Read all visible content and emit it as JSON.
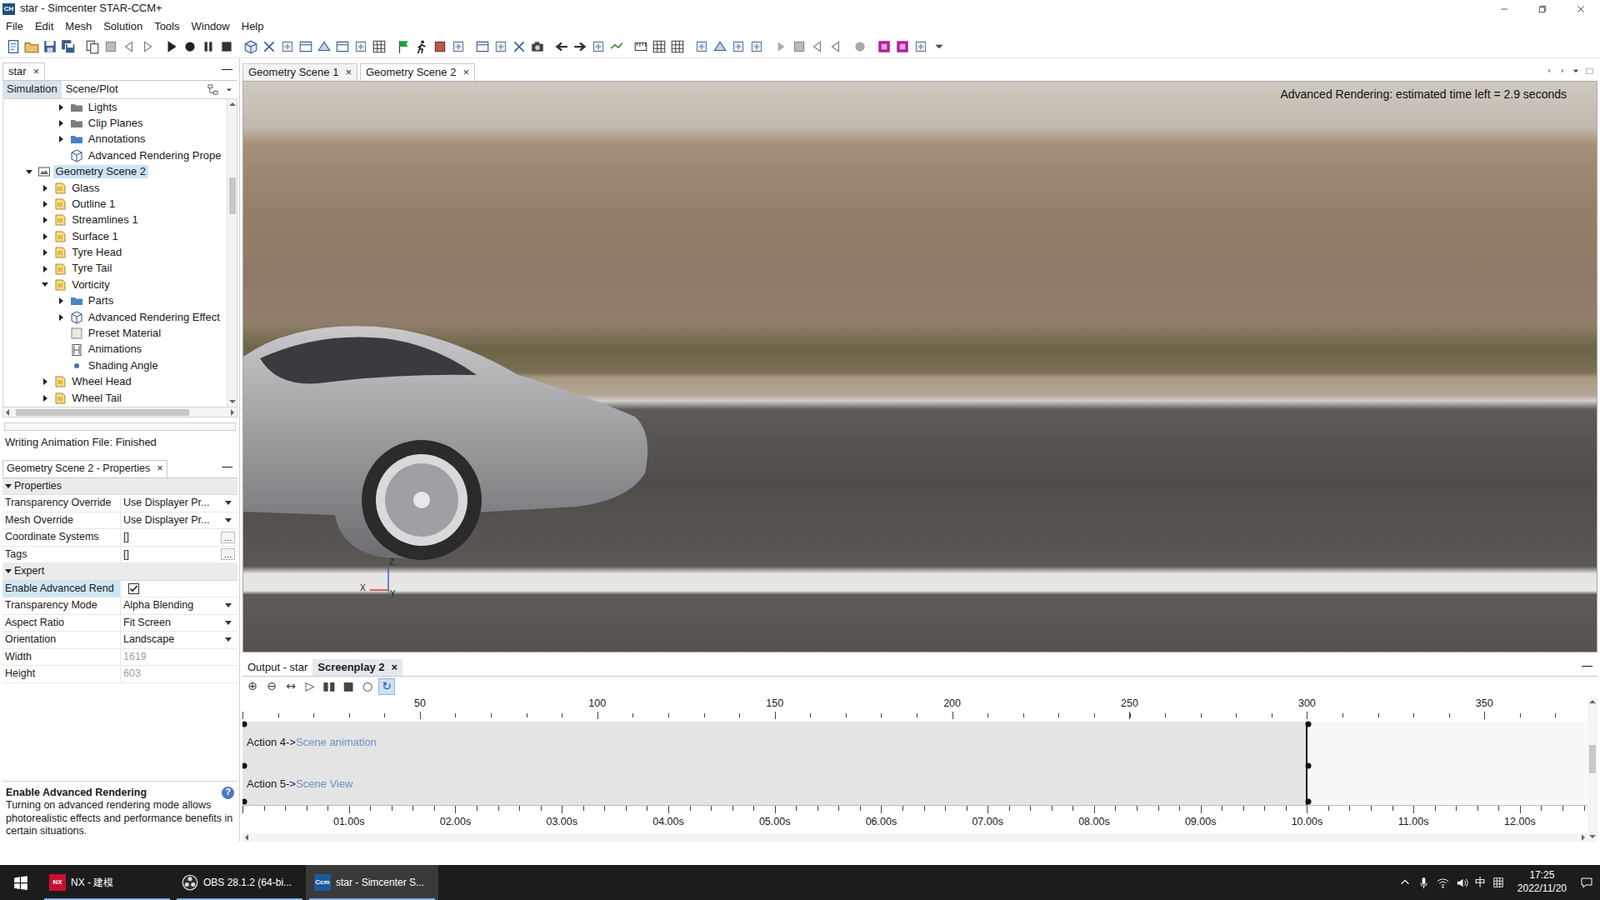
{
  "window": {
    "app_icon": "CH",
    "title": "star - Simcenter STAR-CCM+"
  },
  "menu": [
    "File",
    "Edit",
    "Mesh",
    "Solution",
    "Tools",
    "Window",
    "Help"
  ],
  "sim_panel": {
    "tabs": [
      {
        "label": "star",
        "close": "×",
        "selected": true
      }
    ],
    "minimize": "—",
    "views": [
      {
        "label": "Simulation",
        "selected": true
      },
      {
        "label": "Scene/Plot",
        "selected": false
      }
    ]
  },
  "tree": [
    {
      "label": "Lights",
      "depth": 3,
      "kind": "folder",
      "expandable": true,
      "expanded": false,
      "selected": false
    },
    {
      "label": "Clip Planes",
      "depth": 3,
      "kind": "folder",
      "expandable": true,
      "expanded": false,
      "selected": false
    },
    {
      "label": "Annotations",
      "depth": 3,
      "kind": "folder-blue",
      "expandable": true,
      "expanded": false,
      "selected": false
    },
    {
      "label": "Advanced Rendering Prope",
      "depth": 3,
      "kind": "cube",
      "expandable": false,
      "expanded": false,
      "selected": false
    },
    {
      "label": "Geometry Scene 2",
      "depth": 1,
      "kind": "scene",
      "expandable": true,
      "expanded": true,
      "selected": true
    },
    {
      "label": "Glass",
      "depth": 2,
      "kind": "displayer",
      "expandable": true,
      "expanded": false,
      "selected": false
    },
    {
      "label": "Outline 1",
      "depth": 2,
      "kind": "displayer",
      "expandable": true,
      "expanded": false,
      "selected": false
    },
    {
      "label": "Streamlines 1",
      "depth": 2,
      "kind": "displayer",
      "expandable": true,
      "expanded": false,
      "selected": false
    },
    {
      "label": "Surface 1",
      "depth": 2,
      "kind": "displayer",
      "expandable": true,
      "expanded": false,
      "selected": false
    },
    {
      "label": "Tyre Head",
      "depth": 2,
      "kind": "displayer",
      "expandable": true,
      "expanded": false,
      "selected": false
    },
    {
      "label": "Tyre Tail",
      "depth": 2,
      "kind": "displayer",
      "expandable": true,
      "expanded": false,
      "selected": false
    },
    {
      "label": "Vorticity",
      "depth": 2,
      "kind": "displayer",
      "expandable": true,
      "expanded": true,
      "selected": false
    },
    {
      "label": "Parts",
      "depth": 3,
      "kind": "folder-blue",
      "expandable": true,
      "expanded": false,
      "selected": false
    },
    {
      "label": "Advanced Rendering Effect",
      "depth": 3,
      "kind": "cube",
      "expandable": true,
      "expanded": false,
      "selected": false
    },
    {
      "label": "Preset Material",
      "depth": 3,
      "kind": "material",
      "expandable": false,
      "expanded": false,
      "selected": false
    },
    {
      "label": "Animations",
      "depth": 3,
      "kind": "film",
      "expandable": false,
      "expanded": false,
      "selected": false
    },
    {
      "label": "Shading Angle",
      "depth": 3,
      "kind": "dot",
      "expandable": false,
      "expanded": false,
      "selected": false
    },
    {
      "label": "Wheel Head",
      "depth": 2,
      "kind": "displayer",
      "expandable": true,
      "expanded": false,
      "selected": false
    },
    {
      "label": "Wheel Tail",
      "depth": 2,
      "kind": "displayer",
      "expandable": true,
      "expanded": false,
      "selected": false
    }
  ],
  "tree_status": {
    "level": 0,
    "text": "Writing Animation File: Finished"
  },
  "properties": {
    "title": "Geometry Scene 2 - Properties",
    "close": "×",
    "minimize": "—",
    "sections": [
      {
        "label": "Properties",
        "expanded": true,
        "rows": [
          {
            "name": "Transparency Override",
            "value": "Use Displayer Pr...",
            "kind": "dropdown",
            "selected": false,
            "disabled": false
          },
          {
            "name": "Mesh Override",
            "value": "Use Displayer Pr...",
            "kind": "dropdown",
            "selected": false,
            "disabled": false
          },
          {
            "name": "Coordinate Systems",
            "value": "[]",
            "kind": "button",
            "button": "...",
            "selected": false,
            "disabled": false
          },
          {
            "name": "Tags",
            "value": "[]",
            "kind": "button",
            "button": "...",
            "selected": false,
            "disabled": false
          }
        ]
      },
      {
        "label": "Expert",
        "expanded": true,
        "rows": [
          {
            "name": "Enable Advanced Rend",
            "kind": "checkbox",
            "checked": true,
            "selected": true,
            "disabled": false
          },
          {
            "name": "Transparency Mode",
            "value": "Alpha Blending",
            "kind": "dropdown",
            "selected": false,
            "disabled": false
          },
          {
            "name": "Aspect Ratio",
            "value": "Fit Screen",
            "kind": "dropdown",
            "selected": false,
            "disabled": false
          },
          {
            "name": "Orientation",
            "value": "Landscape",
            "kind": "dropdown",
            "selected": false,
            "disabled": false
          },
          {
            "name": "Width",
            "value": "1619",
            "kind": "text",
            "selected": false,
            "disabled": true
          },
          {
            "name": "Height",
            "value": "603",
            "kind": "text",
            "selected": false,
            "disabled": true
          }
        ]
      }
    ],
    "help": {
      "title": "Enable Advanced Rendering",
      "icon": "?",
      "text": "Turning on advanced rendering mode allows photorealistic effects and performance benefits in certain situations."
    }
  },
  "scene_tabs": [
    {
      "label": "Geometry Scene 1",
      "close": "×",
      "selected": false
    },
    {
      "label": "Geometry Scene 2",
      "close": "×",
      "selected": true
    }
  ],
  "viewport": {
    "overlay": "Advanced Rendering: estimated time left = 2.9 seconds",
    "axes": {
      "z": "Z",
      "x": "X",
      "y": "Y"
    }
  },
  "screenplay": {
    "tabs": [
      {
        "label": "Output - star",
        "selected": false
      },
      {
        "label": "Screenplay 2",
        "close": "×",
        "selected": true
      }
    ],
    "minimize": "—",
    "controls": [
      {
        "glyph": "⊕",
        "on": false
      },
      {
        "glyph": "⊖",
        "on": false
      },
      {
        "glyph": "↔",
        "on": false
      },
      {
        "glyph": "▷",
        "on": false
      },
      {
        "glyph": "▮▮",
        "on": false
      },
      {
        "glyph": "■",
        "on": false
      },
      {
        "glyph": "○",
        "on": false
      },
      {
        "glyph": "↻",
        "on": true
      }
    ],
    "frame_labels": [
      "50",
      "100",
      "150",
      "200",
      "250",
      "300",
      "350"
    ],
    "time_labels": [
      "01.00s",
      "02.00s",
      "03.00s",
      "04.00s",
      "05.00s",
      "06.00s",
      "07.00s",
      "08.00s",
      "09.00s",
      "10.00s",
      "11.00s",
      "12.00s"
    ],
    "actions": [
      {
        "label": "Action 4->",
        "target": "Scene animation",
        "frames": [
          0,
          300
        ]
      },
      {
        "label": "Action 5->",
        "target": "Scene View",
        "frames": [
          0,
          300
        ]
      }
    ]
  },
  "taskbar": {
    "apps": [
      {
        "kind": "nx",
        "badge": "NX",
        "label": "NX - 建模",
        "selected": false
      },
      {
        "kind": "obs",
        "label": "OBS 28.1.2 (64-bi...",
        "selected": false
      },
      {
        "kind": "ccm",
        "badge": "Ccm",
        "label": "star - Simcenter S...",
        "selected": true
      }
    ],
    "ime": "中",
    "time": "17:25",
    "date": "2022/11/20"
  }
}
